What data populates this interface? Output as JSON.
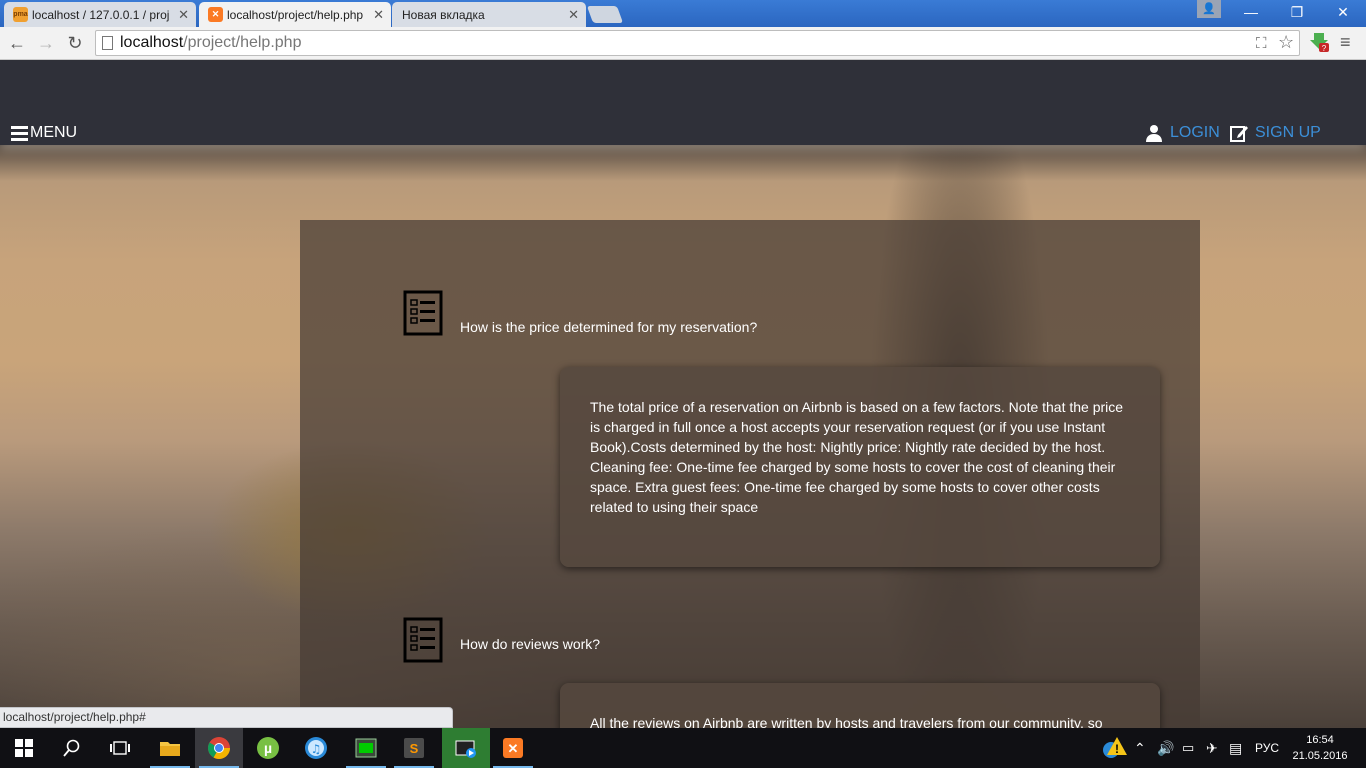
{
  "browser": {
    "tabs": [
      {
        "title": "localhost / 127.0.0.1 / proj",
        "favicon": "phpmyadmin-icon",
        "active": false
      },
      {
        "title": "localhost/project/help.php",
        "favicon": "xampp-icon",
        "active": true
      },
      {
        "title": "Новая вкладка",
        "favicon": "",
        "active": false
      }
    ],
    "url_host": "localhost",
    "url_path": "/project/help.php",
    "status_url": "localhost/project/help.php#"
  },
  "site": {
    "menu_label": "MENU",
    "login_label": "LOGIN",
    "signup_label": "SIGN UP",
    "link_color": "#3c8fd8"
  },
  "faq": [
    {
      "question": "How is the price determined for my reservation?",
      "answer": "The total price of a reservation on Airbnb is based on a few factors. Note that the price is charged in full once a host accepts your reservation request (or if you use Instant Book).Costs determined by the host: Nightly price: Nightly rate decided by the host. Cleaning fee: One-time fee charged by some hosts to cover the cost of cleaning their space. Extra guest fees: One-time fee charged by some hosts to cover other costs related to using their space"
    },
    {
      "question": "How do reviews work?",
      "answer": "All the reviews on Airbnb are written by hosts and travelers from our community, so"
    }
  ],
  "taskbar": {
    "apps": [
      "start-icon",
      "search-icon",
      "task-view-icon",
      "file-explorer-icon",
      "chrome-icon",
      "utorrent-icon",
      "itunes-icon",
      "terminal-icon",
      "sublime-icon",
      "media-icon",
      "xampp-icon"
    ],
    "language": "РУС",
    "time": "16:54",
    "date": "21.05.2016"
  }
}
